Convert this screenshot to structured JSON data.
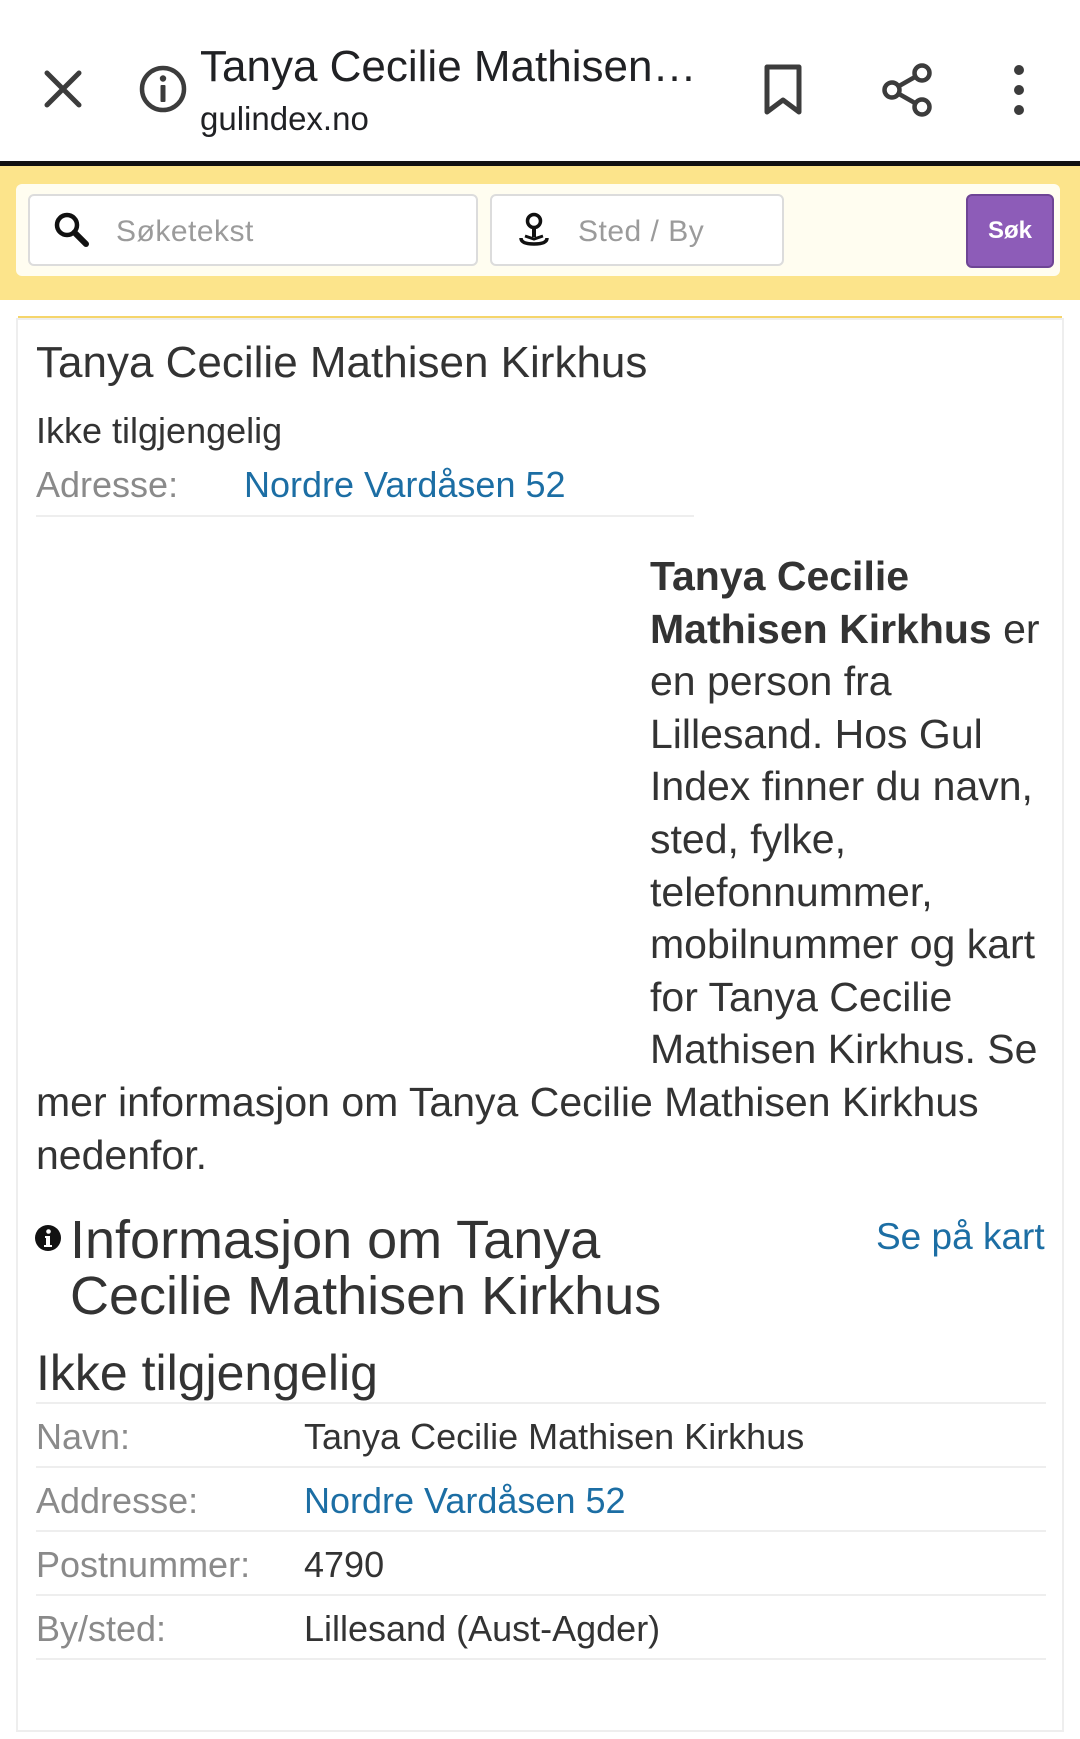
{
  "browser": {
    "title": "Tanya Cecilie Mathisen Kirkhus",
    "domain": "gulindex.no",
    "icons": [
      "close-icon",
      "info-icon",
      "bookmark-icon",
      "share-icon",
      "more-vert-icon"
    ]
  },
  "search": {
    "query_placeholder": "Søketekst",
    "place_placeholder": "Sted / By",
    "button_label": "Søk",
    "accent_color": "#8d5cb8",
    "band_color": "#fce48b"
  },
  "person": {
    "heading": "Tanya Cecilie Mathisen Kirkhus",
    "status": "Ikke tilgjengelig",
    "address_label": "Adresse:",
    "address_link": "Nordre Vardåsen 52"
  },
  "description": {
    "name_bold": "Tanya Cecilie Mathisen Kirkhus",
    "text": " er en person fra Lillesand. Hos Gul Index finner du navn, sted, fylke, telefonnummer, mobilnummer og kart for Tanya Cecilie Mathisen Kirkhus. Se mer informasjon om Tanya Cecilie Mathisen Kirkhus nedenfor."
  },
  "info": {
    "heading": "Informasjon om Tanya Cecilie Mathisen Kirkhus",
    "map_link": "Se på kart",
    "status": "Ikke tilgjengelig",
    "rows": [
      {
        "label": "Navn:",
        "value": "Tanya Cecilie Mathisen Kirkhus"
      },
      {
        "label": "Addresse:",
        "value": "Nordre Vardåsen 52"
      },
      {
        "label": "Postnummer:",
        "value": "4790"
      },
      {
        "label": "By/sted:",
        "value": "Lillesand (Aust-Agder)"
      }
    ]
  },
  "colors": {
    "link": "#1c6ea4",
    "text": "#333333",
    "muted": "#8a8a8a"
  }
}
